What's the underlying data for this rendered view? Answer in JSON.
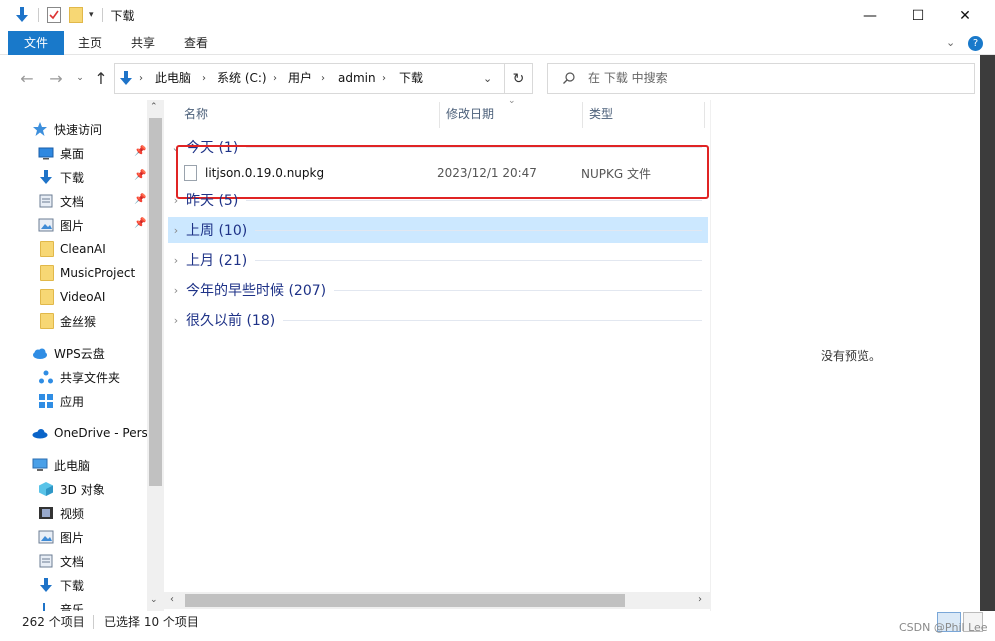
{
  "window": {
    "title": "下载",
    "minimize_glyph": "—",
    "maximize_glyph": "☐",
    "close_glyph": "✕"
  },
  "ribbon": {
    "tabs": [
      "文件",
      "主页",
      "共享",
      "查看"
    ]
  },
  "address": {
    "crumbs": [
      "此电脑",
      "系统 (C:)",
      "用户",
      "admin",
      "下载"
    ],
    "search_placeholder": "在 下载 中搜索"
  },
  "sidebar": {
    "quick_access": "快速访问",
    "pinned": [
      "桌面",
      "下载",
      "文档",
      "图片"
    ],
    "folders": [
      "CleanAI",
      "MusicProject",
      "VideoAI",
      "金丝猴"
    ],
    "wps": "WPS云盘",
    "shared": "共享文件夹",
    "apps": "应用",
    "onedrive": "OneDrive - Perso",
    "this_pc": "此电脑",
    "pc_items": [
      "3D 对象",
      "视频",
      "图片",
      "文档",
      "下载",
      "音乐"
    ]
  },
  "columns": {
    "name": "名称",
    "date": "修改日期",
    "type": "类型"
  },
  "groups": [
    {
      "label": "今天 (1)",
      "expanded": true
    },
    {
      "label": "昨天 (5)",
      "expanded": false
    },
    {
      "label": "上周 (10)",
      "expanded": false,
      "selected": true
    },
    {
      "label": "上月 (21)",
      "expanded": false
    },
    {
      "label": "今年的早些时候 (207)",
      "expanded": false
    },
    {
      "label": "很久以前 (18)",
      "expanded": false
    }
  ],
  "file": {
    "name": "litjson.0.19.0.nupkg",
    "date": "2023/12/1 20:47",
    "type": "NUPKG 文件"
  },
  "preview": {
    "empty_text": "没有预览。"
  },
  "status": {
    "item_count": "262 个项目",
    "selected": "已选择 10 个项目",
    "watermark": "CSDN @Phil Lee"
  },
  "colors": {
    "accent": "#1979ca",
    "selection": "#cce8ff",
    "highlight_box": "#e02424",
    "group_text": "#1e3287"
  }
}
